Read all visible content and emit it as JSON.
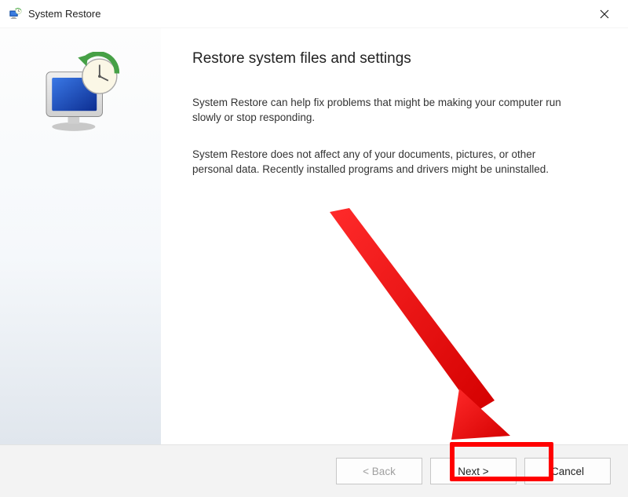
{
  "titlebar": {
    "title": "System Restore"
  },
  "content": {
    "heading": "Restore system files and settings",
    "para1": "System Restore can help fix problems that might be making your computer run slowly or stop responding.",
    "para2": "System Restore does not affect any of your documents, pictures, or other personal data. Recently installed programs and drivers might be uninstalled."
  },
  "footer": {
    "back_label": "< Back",
    "next_label": "Next >",
    "cancel_label": "Cancel"
  }
}
